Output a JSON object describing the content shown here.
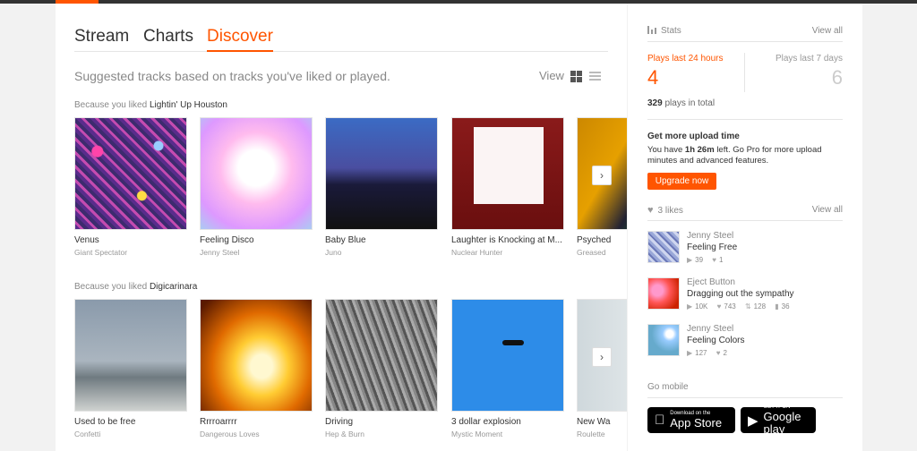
{
  "nav": {
    "tabs": [
      {
        "label": "Stream"
      },
      {
        "label": "Charts"
      },
      {
        "label": "Discover"
      }
    ],
    "active_tab": "Discover"
  },
  "discover": {
    "suggest_text": "Suggested tracks based on tracks you've liked or played.",
    "view_label": "View",
    "sections": [
      {
        "because_prefix": "Because you liked",
        "because_track": "Lightin' Up Houston",
        "tracks": [
          {
            "title": "Venus",
            "artist": "Giant Spectator"
          },
          {
            "title": "Feeling Disco",
            "artist": "Jenny Steel"
          },
          {
            "title": "Baby Blue",
            "artist": "Juno"
          },
          {
            "title": "Laughter is Knocking at M...",
            "artist": "Nuclear Hunter"
          },
          {
            "title": "Psyched",
            "artist": "Greased"
          }
        ]
      },
      {
        "because_prefix": "Because you liked",
        "because_track": "Digicarinara",
        "tracks": [
          {
            "title": "Used to be free",
            "artist": "Confetti"
          },
          {
            "title": "Rrrroarrrr",
            "artist": "Dangerous Loves"
          },
          {
            "title": "Driving",
            "artist": "Hep & Burn"
          },
          {
            "title": "3 dollar explosion",
            "artist": "Mystic Moment"
          },
          {
            "title": "New Wa",
            "artist": "Roulette"
          }
        ]
      }
    ]
  },
  "sidebar": {
    "stats": {
      "heading": "Stats",
      "view_all": "View all",
      "plays_24h_label": "Plays last 24 hours",
      "plays_24h_value": "4",
      "plays_7d_label": "Plays last 7 days",
      "plays_7d_value": "6",
      "total_count": "329",
      "total_suffix": "plays in total"
    },
    "upload": {
      "title": "Get more upload time",
      "text_prefix": "You have",
      "time_left": "1h 26m",
      "text_suffix": "left. Go Pro for more upload minutes and advanced features.",
      "button": "Upgrade now"
    },
    "likes": {
      "heading": "3 likes",
      "view_all": "View all",
      "items": [
        {
          "user": "Jenny Steel",
          "title": "Feeling Free",
          "plays": "39",
          "likes": "1",
          "reposts": "",
          "comments": ""
        },
        {
          "user": "Eject Button",
          "title": "Dragging out the sympathy",
          "plays": "10K",
          "likes": "743",
          "reposts": "128",
          "comments": "36"
        },
        {
          "user": "Jenny Steel",
          "title": "Feeling Colors",
          "plays": "127",
          "likes": "2",
          "reposts": "",
          "comments": ""
        }
      ]
    },
    "mobile": {
      "heading": "Go mobile",
      "appstore_small": "Download on the",
      "appstore_big": "App Store",
      "google_small": "GET IT ON",
      "google_big": "Google play"
    }
  },
  "colors": {
    "accent": "#ff5500",
    "text": "#333333",
    "muted": "#888888"
  }
}
